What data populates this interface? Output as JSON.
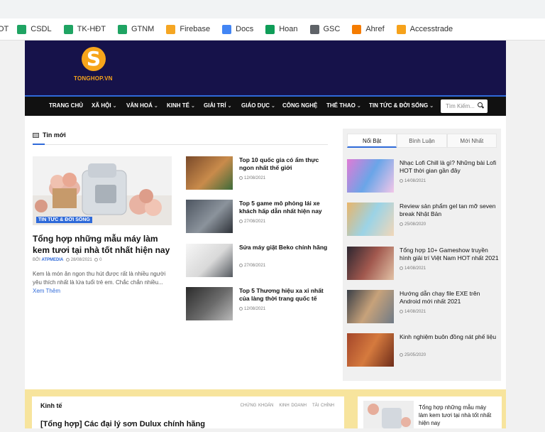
{
  "bookmarks": [
    {
      "label": "OT",
      "icon": "bookmark-cut-icon",
      "color": "#777"
    },
    {
      "label": "CSDL",
      "icon": "google-drive-icon",
      "color": "#1fa463"
    },
    {
      "label": "TK-HĐT",
      "icon": "google-drive-icon",
      "color": "#1fa463"
    },
    {
      "label": "GTNM",
      "icon": "google-drive-icon",
      "color": "#1fa463"
    },
    {
      "label": "Firebase",
      "icon": "firebase-icon",
      "color": "#f5a623"
    },
    {
      "label": "Docs",
      "icon": "google-docs-icon",
      "color": "#4285f4"
    },
    {
      "label": "Hoan",
      "icon": "google-sheets-icon",
      "color": "#0f9d58"
    },
    {
      "label": "GSC",
      "icon": "search-console-icon",
      "color": "#5f6368"
    },
    {
      "label": "Ahref",
      "icon": "ahrefs-icon",
      "color": "#f57c00"
    },
    {
      "label": "Accesstrade",
      "icon": "accesstrade-icon",
      "color": "#f6a21b"
    }
  ],
  "header": {
    "logo_letter": "S",
    "logo_text": "TONGHOP.VN",
    "bg_color": "#16124a",
    "accent": "#f7a51b"
  },
  "nav": {
    "items": [
      {
        "label": "TRANG CHỦ",
        "caret": false
      },
      {
        "label": "XÃ HỘI",
        "caret": true
      },
      {
        "label": "VĂN HOÁ",
        "caret": true
      },
      {
        "label": "KINH TẾ",
        "caret": true
      },
      {
        "label": "GIẢI TRÍ",
        "caret": true
      },
      {
        "label": "GIÁO DỤC",
        "caret": true
      },
      {
        "label": "CÔNG NGHỆ",
        "caret": false
      },
      {
        "label": "THỂ THAO",
        "caret": true
      },
      {
        "label": "TIN TỨC & ĐỜI SỐNG",
        "caret": true
      }
    ],
    "search_placeholder": "Tìm Kiếm...",
    "accent": "#2f6ad9"
  },
  "latest": {
    "title": "Tin mới",
    "featured": {
      "tag": "TIN TỨC & ĐỜI SỐNG",
      "title": "Tổng hợp những mẫu máy làm kem tươi tại nhà tốt nhất hiện nay",
      "author_prefix": "BỞI",
      "author": "ATPMEDIA",
      "date": "28/08/2021",
      "comments": "0",
      "excerpt": "Kem là món ăn ngon thu hút được rất là nhiều người yêu thích nhất là lứa tuổi trẻ em. Chắc chắn nhiều...",
      "read_more": "Xem Thêm"
    },
    "list": [
      {
        "title": "Top 10 quốc gia có ẩm thực ngon nhất thế giới",
        "date": "12/08/2021"
      },
      {
        "title": "Top 5 game mô phỏng lái xe khách hấp dẫn nhất hiện nay",
        "date": "27/08/2021"
      },
      {
        "title": "Sửa máy giặt Beko chính hãng",
        "date": "27/08/2021"
      },
      {
        "title": "Top 5 Thương hiệu xa xỉ nhất của làng thời trang quốc tế",
        "date": "12/08/2021"
      }
    ]
  },
  "sidebar": {
    "tabs": [
      "Nổi Bật",
      "Bình Luận",
      "Mới Nhất"
    ],
    "active_tab": 0,
    "items": [
      {
        "title": "Nhạc Lofi Chill là gì? Những bài Lofi HOT thời gian gần đây",
        "date": "14/08/2021"
      },
      {
        "title": "Review sản phẩm gel tan mỡ seven break Nhật Bản",
        "date": "25/08/2020"
      },
      {
        "title": "Tổng hợp 10+ Gameshow truyền hình giải trí Việt Nam HOT nhất 2021",
        "date": "14/08/2021"
      },
      {
        "title": "Hướng dẫn chạy file EXE trên Android mới nhất 2021",
        "date": "14/08/2021"
      },
      {
        "title": "Kinh nghiệm buôn đồng nát phế liệu",
        "date": "25/05/2020"
      }
    ]
  },
  "economy": {
    "title": "Kinh tế",
    "tabs": [
      "CHỨNG KHOÁN",
      "KINH DOANH",
      "TÀI CHÍNH"
    ],
    "headline": "[Tổng hợp] Các đại lý sơn Dulux chính hãng"
  },
  "promo": {
    "title": "Tổng hợp những mẫu máy làm kem tươi tại nhà tốt nhất hiện nay"
  }
}
